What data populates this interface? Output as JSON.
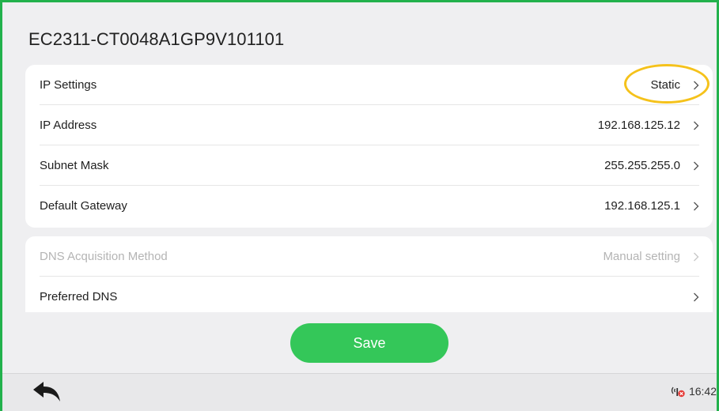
{
  "header": {
    "title": "EC2311-CT0048A1GP9V101101"
  },
  "network_card": {
    "rows": [
      {
        "label": "IP Settings",
        "value": "Static"
      },
      {
        "label": "IP Address",
        "value": "192.168.125.12"
      },
      {
        "label": "Subnet Mask",
        "value": "255.255.255.0"
      },
      {
        "label": "Default Gateway",
        "value": "192.168.125.1"
      }
    ]
  },
  "dns_card": {
    "rows": [
      {
        "label": "DNS Acquisition Method",
        "value": "Manual setting",
        "disabled": true
      },
      {
        "label": "Preferred DNS",
        "value": ""
      }
    ]
  },
  "actions": {
    "save_label": "Save"
  },
  "status_bar": {
    "time": "16:42",
    "network_icon": "network-disconnected-icon"
  },
  "colors": {
    "accent": "#34c759",
    "highlight": "#f5c21b",
    "frame": "#22b14c"
  }
}
